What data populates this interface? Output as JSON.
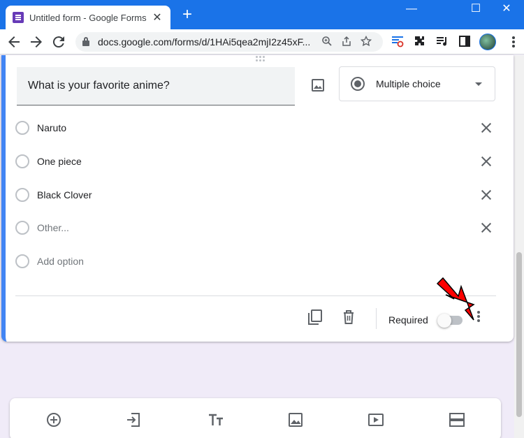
{
  "browser": {
    "tab_title": "Untitled form - Google Forms",
    "tab_close": "✕",
    "new_tab": "+",
    "url": "docs.google.com/forms/d/1HAi5qea2mjI2z45xF...",
    "window_minimize": "—",
    "window_maximize": "☐",
    "window_close": "✕"
  },
  "question": {
    "title": "What is your favorite anime?",
    "type": "Multiple choice",
    "options": [
      {
        "label": "Naruto"
      },
      {
        "label": "One piece"
      },
      {
        "label": "Black Clover"
      },
      {
        "label": "Other..."
      }
    ],
    "add_option": "Add option",
    "required_label": "Required",
    "required": false
  },
  "colors": {
    "accent": "#4285f4",
    "chrome_blue": "#1a73e8",
    "form_purple": "#673ab7",
    "annotation_arrow": "#ff0000"
  },
  "icons": [
    "forms-favicon",
    "lock-icon",
    "zoom-icon",
    "share-icon",
    "star-icon",
    "extensions-icon",
    "media-icon",
    "sidepanel-icon",
    "image-icon",
    "duplicate-icon",
    "trash-icon",
    "more-vert-icon",
    "add-question-icon",
    "import-icon",
    "title-icon",
    "add-image-icon",
    "add-video-icon",
    "add-section-icon"
  ]
}
